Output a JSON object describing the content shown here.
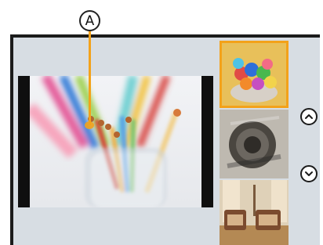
{
  "callout": {
    "label": "A"
  },
  "preview": {
    "subject": "colored-pencils-in-glass"
  },
  "thumbnails": [
    {
      "subject": "candy-in-bowl",
      "selected": true
    },
    {
      "subject": "vintage-camera",
      "selected": false
    },
    {
      "subject": "chairs-in-room",
      "selected": false
    }
  ],
  "navigation": {
    "up_icon": "chevron-up-icon",
    "down_icon": "chevron-down-icon"
  },
  "colors": {
    "accent": "#f3a21a",
    "screen_bg": "#d7dde3",
    "frame": "#1b1b1b"
  }
}
